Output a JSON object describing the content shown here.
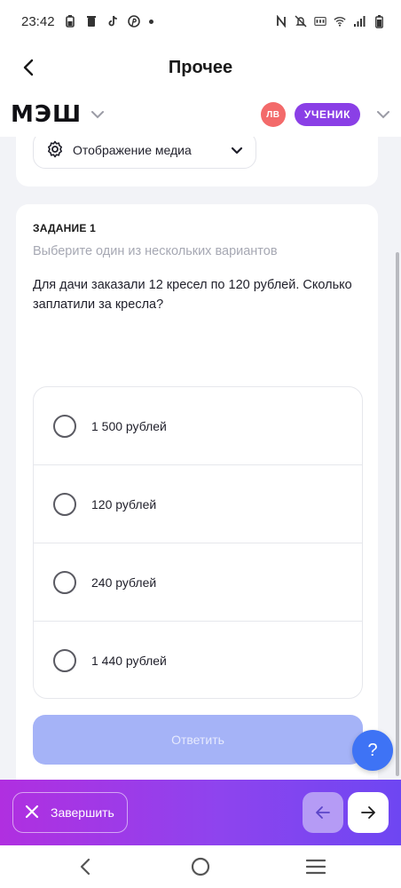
{
  "status_bar": {
    "time": "23:42",
    "left_icons": [
      "battery-saver-icon",
      "trash-icon",
      "tiktok-icon",
      "pinterest-icon",
      "dot-icon"
    ],
    "right_icons": [
      "nfc-icon",
      "mute-icon",
      "volte-icon",
      "wifi-icon",
      "signal-icon",
      "battery-icon"
    ]
  },
  "app_bar": {
    "title": "Прочее",
    "back_icon": "chevron-left-icon"
  },
  "header": {
    "logo": "МЭШ",
    "avatar_initials": "ЛВ",
    "role": "УЧЕНИК",
    "colors": {
      "avatar": "#F36A6A",
      "role_badge": "#8A3FE6"
    }
  },
  "media": {
    "label": "Отображение медиа",
    "icon": "gear-icon"
  },
  "task": {
    "label": "ЗАДАНИЕ 1",
    "hint": "Выберите один из нескольких вариантов",
    "question": "Для дачи заказали 12 кресел по 120 рублей. Сколько заплатили за кресла?",
    "options": [
      {
        "label": "1 500 рублей"
      },
      {
        "label": "120 рублей"
      },
      {
        "label": "240 рублей"
      },
      {
        "label": "1 440 рублей"
      }
    ],
    "answer_label": "Ответить"
  },
  "help": {
    "label": "?"
  },
  "bottom_bar": {
    "finish_label": "Завершить",
    "prev_icon": "arrow-left-icon",
    "next_icon": "arrow-right-icon"
  },
  "sys_nav": {
    "icons": [
      "back-triangle-icon",
      "home-circle-icon",
      "recents-icon"
    ]
  }
}
